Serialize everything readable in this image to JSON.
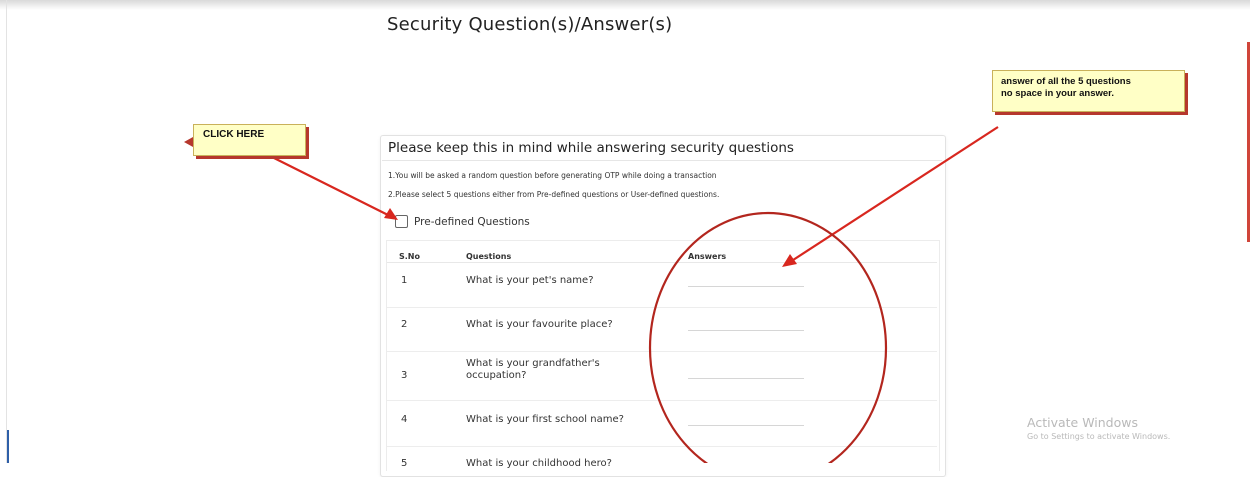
{
  "page": {
    "title": "Security Question(s)/Answer(s)"
  },
  "instructions": {
    "heading": "Please keep this in mind while answering security questions",
    "notes": [
      "1.You will be asked a random question before generating OTP while doing a transaction",
      "2.Please select 5 questions either from Pre-defined questions or User-defined questions."
    ]
  },
  "predefined": {
    "label": "Pre-defined Questions",
    "checked": false
  },
  "table": {
    "headers": {
      "sno": "S.No",
      "question": "Questions",
      "answer": "Answers"
    },
    "rows": [
      {
        "sno": "1",
        "question": "What is your pet's name?",
        "answer": ""
      },
      {
        "sno": "2",
        "question": "What is your favourite place?",
        "answer": ""
      },
      {
        "sno": "3",
        "question": "What is your grandfather's occupation?",
        "answer": ""
      },
      {
        "sno": "4",
        "question": "What is your first school name?",
        "answer": ""
      },
      {
        "sno": "5",
        "question": "What is your childhood hero?",
        "answer": ""
      }
    ]
  },
  "annotations": {
    "click_here": "CLICK HERE",
    "answer_note_line1": "answer of all the 5 questions",
    "answer_note_line2": "no space in your answer.",
    "arrow_color": "#d8271f",
    "callout_fill": "#ffffc6"
  },
  "watermark": {
    "title": "Activate Windows",
    "subtitle": "Go to Settings to activate Windows."
  }
}
